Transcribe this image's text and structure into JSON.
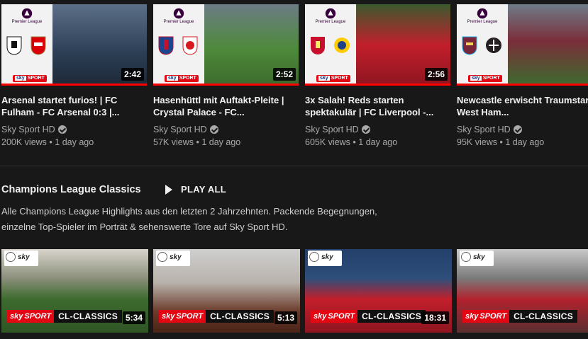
{
  "videos": [
    {
      "title": "Arsenal startet furios! | FC Fulham - FC Arsenal 0:3 |...",
      "channel": "Sky Sport HD",
      "views": "200K views",
      "age": "1 day ago",
      "duration": "2:42",
      "photo_color": "#3f5876"
    },
    {
      "title": "Hasenhüttl mit Auftakt-Pleite | Crystal Palace - FC...",
      "channel": "Sky Sport HD",
      "views": "57K views",
      "age": "1 day ago",
      "duration": "2:52",
      "photo_color": "#4d7a3a"
    },
    {
      "title": "3x Salah! Reds starten spektakulär | FC Liverpool -...",
      "channel": "Sky Sport HD",
      "views": "605K views",
      "age": "1 day ago",
      "duration": "2:56",
      "photo_color": "#b3232f"
    },
    {
      "title": "Newcastle erwischt Traumstart | West Ham...",
      "channel": "Sky Sport HD",
      "views": "95K views",
      "age": "1 day ago",
      "duration": "",
      "photo_color": "#7a2e3a"
    }
  ],
  "pl_label": "Premier League",
  "separator": "•",
  "shelf": {
    "title": "Champions League Classics",
    "play_all": "PLAY ALL",
    "description": "Alle Champions League Highlights aus den letzten 2 Jahrzehnten. Packende Begegnungen, einzelne Top-Spieler im Porträt & sehenswerte Tore auf Sky Sport HD."
  },
  "classics": [
    {
      "duration": "5:34",
      "label": "CL-CLASSICS",
      "photo_color": "#3d6b2e"
    },
    {
      "duration": "5:13",
      "label": "CL-CLASSICS",
      "photo_color": "#6b3a2a"
    },
    {
      "duration": "18:31",
      "label": "CL-CLASSICS",
      "photo_color": "#24406b"
    },
    {
      "duration": "",
      "label": "CL-CLASSICS",
      "photo_color": "#5a3030"
    }
  ],
  "sky_sport_label": "SPORT",
  "sky_label": "sky"
}
